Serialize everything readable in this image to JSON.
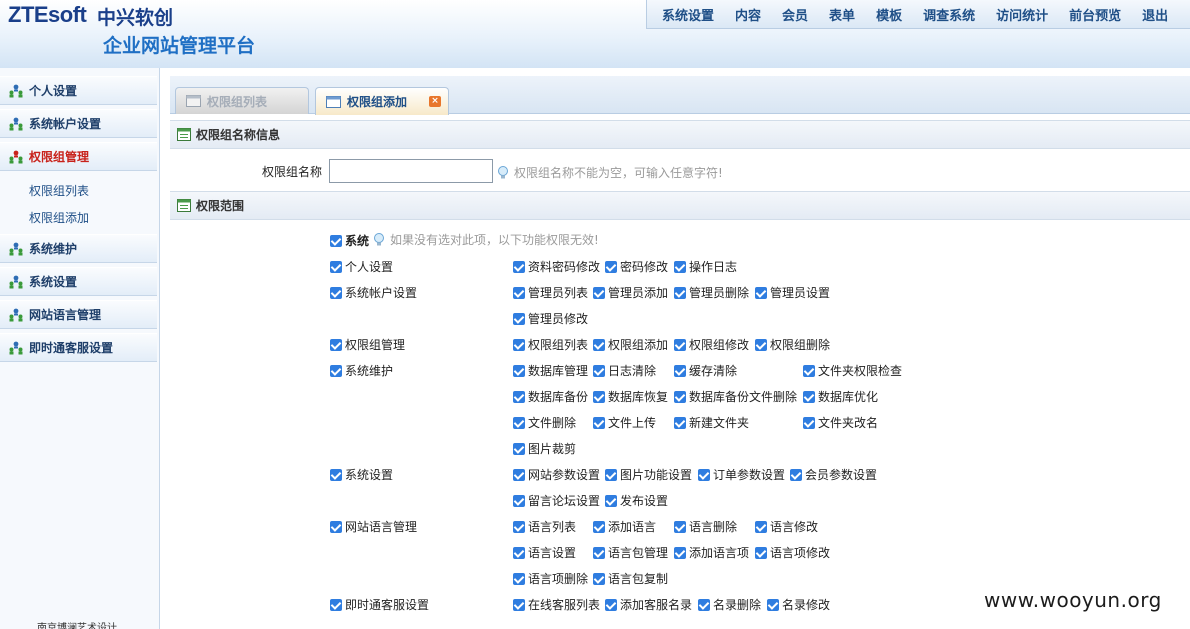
{
  "header": {
    "logo_en": "ZTEsoft",
    "logo_cn": "中兴软创",
    "subtitle": "企业网站管理平台",
    "nav": [
      "系统设置",
      "内容",
      "会员",
      "表单",
      "模板",
      "调查系统",
      "访问统计",
      "前台预览",
      "退出"
    ]
  },
  "sidebar": {
    "items": [
      {
        "label": "个人设置"
      },
      {
        "label": "系统帐户设置"
      },
      {
        "label": "权限组管理",
        "active": true
      },
      {
        "label": "系统维护"
      },
      {
        "label": "系统设置"
      },
      {
        "label": "网站语言管理"
      },
      {
        "label": "即时通客服设置"
      }
    ],
    "subitems": [
      "权限组列表",
      "权限组添加"
    ],
    "footer": "南京博澜艺术设计"
  },
  "tabs": [
    {
      "label": "权限组列表",
      "active": false
    },
    {
      "label": "权限组添加",
      "active": true
    }
  ],
  "form": {
    "section1_title": "权限组名称信息",
    "name_label": "权限组名称",
    "name_value": "",
    "name_hint": "权限组名称不能为空，可输入任意字符!",
    "section2_title": "权限范围",
    "system_label": "系统",
    "system_hint": "如果没有选对此项，以下功能权限无效!"
  },
  "permissions": {
    "groups": [
      "个人设置",
      "系统帐户设置",
      "权限组管理",
      "系统维护",
      "系统设置",
      "网站语言管理",
      "即时通客服设置"
    ],
    "items": [
      "资料密码修改",
      "密码修改",
      "操作日志",
      "管理员列表",
      "管理员添加",
      "管理员删除",
      "管理员设置",
      "管理员修改",
      "权限组列表",
      "权限组添加",
      "权限组修改",
      "权限组删除",
      "数据库管理",
      "日志清除",
      "缓存清除",
      "文件夹权限检查",
      "数据库备份",
      "数据库恢复",
      "数据库备份文件删除",
      "数据库优化",
      "文件删除",
      "文件上传",
      "新建文件夹",
      "文件夹改名",
      "图片裁剪",
      "网站参数设置",
      "图片功能设置",
      "订单参数设置",
      "会员参数设置",
      "留言论坛设置",
      "发布设置",
      "语言列表",
      "添加语言",
      "语言删除",
      "语言修改",
      "语言设置",
      "语言包管理",
      "添加语言项",
      "语言项修改",
      "语言项删除",
      "语言包复制",
      "在线客服列表",
      "添加客服名录",
      "名录删除",
      "名录修改"
    ]
  },
  "watermark": "www.wooyun.org",
  "colors": {
    "accent": "#2f7de0",
    "active_nav": "#c8221b",
    "link": "#1f4f87"
  }
}
